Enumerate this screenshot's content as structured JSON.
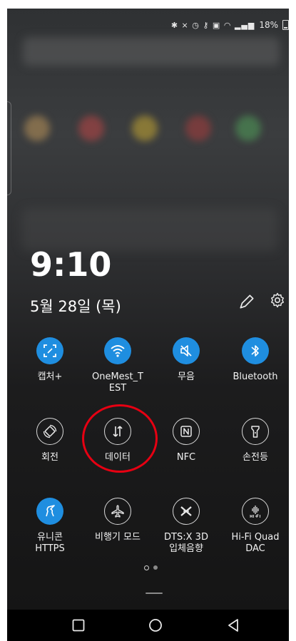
{
  "status_bar": {
    "battery_text": "18%",
    "icons": [
      "bluetooth-icon",
      "mute-icon",
      "alarm-icon",
      "key-icon",
      "hd-icon",
      "wifi-icon",
      "signal-icon",
      "battery-icon"
    ]
  },
  "lockscreen": {
    "time": "9:10",
    "date": "5월 28일 (목)"
  },
  "quick_settings": {
    "rows": [
      [
        {
          "id": "capture",
          "label": "캡처+",
          "icon": "capture-icon",
          "active": true
        },
        {
          "id": "wifi",
          "label": "OneMest_T\nEST",
          "icon": "wifi-icon",
          "active": true
        },
        {
          "id": "mute",
          "label": "무음",
          "icon": "mute-icon",
          "active": true
        },
        {
          "id": "bluetooth",
          "label": "Bluetooth",
          "icon": "bluetooth-icon",
          "active": true
        }
      ],
      [
        {
          "id": "rotate",
          "label": "회전",
          "icon": "rotate-icon",
          "active": false
        },
        {
          "id": "data",
          "label": "데이터",
          "icon": "data-arrows-icon",
          "active": false
        },
        {
          "id": "nfc",
          "label": "NFC",
          "icon": "nfc-icon",
          "active": false
        },
        {
          "id": "flashlight",
          "label": "손전등",
          "icon": "flashlight-icon",
          "active": false
        }
      ],
      [
        {
          "id": "unicorn",
          "label": "유니콘\nHTTPS",
          "icon": "unicorn-icon",
          "active": true
        },
        {
          "id": "airplane",
          "label": "비행기 모드",
          "icon": "airplane-icon",
          "active": false
        },
        {
          "id": "dtsx",
          "label": "DTS:X 3D\n입체음향",
          "icon": "dtsx-icon",
          "active": false
        },
        {
          "id": "hifi",
          "label": "Hi-Fi Quad\nDAC",
          "icon": "hifi-icon",
          "active": false
        }
      ]
    ],
    "page_indicator": {
      "current": 1,
      "total": 2
    }
  },
  "nav_bar": {
    "buttons": [
      "recent-apps-icon",
      "home-icon",
      "back-icon"
    ]
  },
  "colors": {
    "active_tile": "#1f8ee0",
    "highlight": "#e60012"
  }
}
